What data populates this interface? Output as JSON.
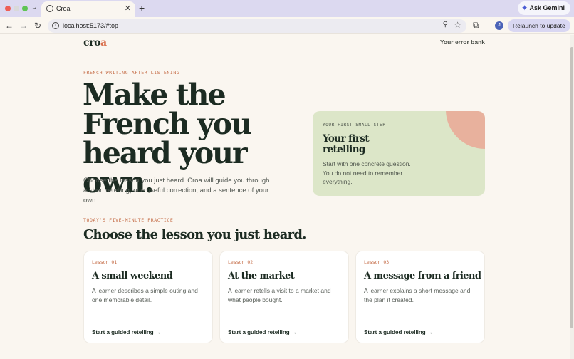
{
  "browser": {
    "tab_title": "Croa",
    "tab_close": "✕",
    "new_tab": "+",
    "ask_gemini": "Ask Gemini",
    "url": "localhost:5173/#top",
    "relaunch": "Relaunch to update",
    "avatar_initial": "J"
  },
  "site": {
    "brand_main": "cro",
    "brand_accent": "a",
    "nav_link": "Your error bank"
  },
  "hero": {
    "eyebrow": "FRENCH WRITING AFTER LISTENING",
    "title": "Make the French you heard your own.",
    "subtitle": "Choose the lesson you just heard. Croa will guide you through a short retelling, one useful correction, and a sentence of your own."
  },
  "step_card": {
    "eyebrow": "YOUR FIRST SMALL STEP",
    "title": "Your first retelling",
    "text": "Start with one concrete question. You do not need to remember everything."
  },
  "practice": {
    "eyebrow": "TODAY'S FIVE-MINUTE PRACTICE",
    "title": "Choose the lesson you just heard.",
    "lessons": [
      {
        "number": "Lesson 01",
        "title": "A small weekend",
        "description": "A learner describes a simple outing and one memorable detail.",
        "cta": "Start a guided retelling →"
      },
      {
        "number": "Lesson 02",
        "title": "At the market",
        "description": "A learner retells a visit to a market and what people bought.",
        "cta": "Start a guided retelling →"
      },
      {
        "number": "Lesson 03",
        "title": "A message from a friend",
        "description": "A learner explains a short message and the plan it created.",
        "cta": "Start a guided retelling →"
      }
    ]
  },
  "colors": {
    "ink": "#1c2b22",
    "accent": "#d9704e",
    "step_card_bg": "#dce6c8",
    "step_circle": "#e8b19d",
    "page_bg": "#faf6f0"
  }
}
